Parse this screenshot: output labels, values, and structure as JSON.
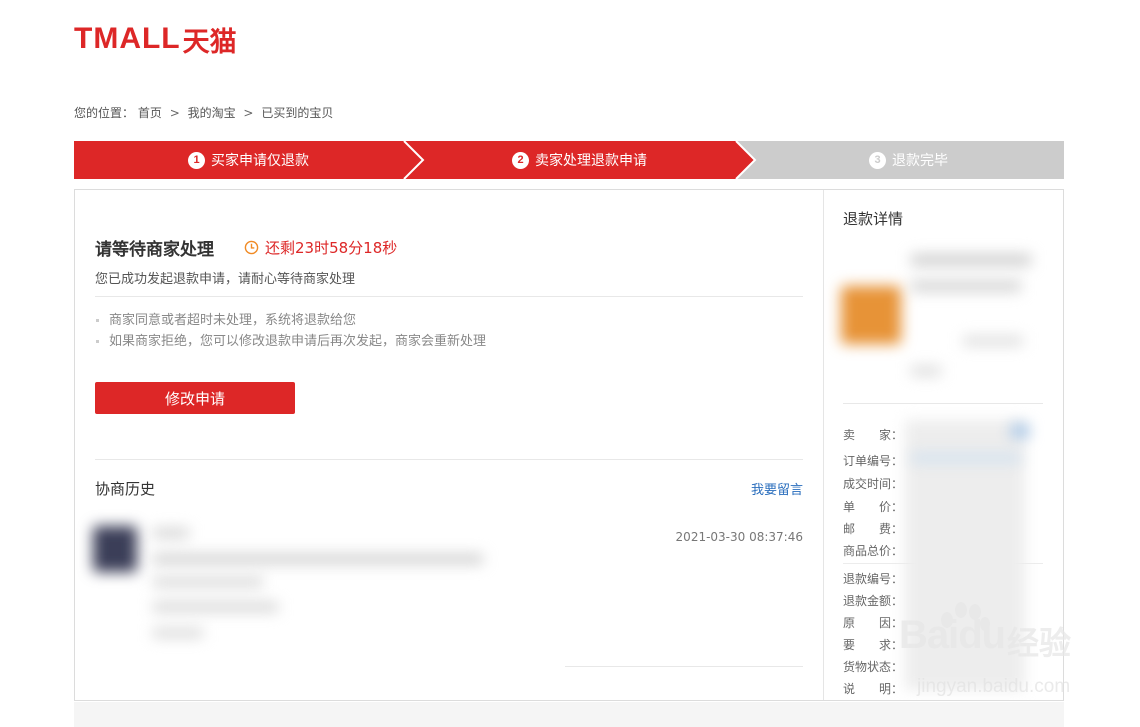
{
  "header": {
    "logo_latin": "TMALL",
    "logo_cn": "天猫"
  },
  "breadcrumb": {
    "prefix": "您的位置：",
    "items": [
      "首页",
      "我的淘宝",
      "已买到的宝贝"
    ],
    "separator": ">"
  },
  "steps": [
    {
      "num": "1",
      "label": "买家申请仅退款",
      "state": "active"
    },
    {
      "num": "2",
      "label": "卖家处理退款申请",
      "state": "active"
    },
    {
      "num": "3",
      "label": "退款完毕",
      "state": "pending"
    }
  ],
  "colors": {
    "brand_red": "#dd2727",
    "step_grey": "#cccccc",
    "link_blue": "#2a6ebd"
  },
  "status": {
    "title": "请等待商家处理",
    "countdown": "还剩23时58分18秒",
    "subtitle": "您已成功发起退款申请，请耐心等待商家处理",
    "tips": [
      "商家同意或者超时未处理，系统将退款给您",
      "如果商家拒绝，您可以修改退款申请后再次发起，商家会重新处理"
    ],
    "modify_button": "修改申请"
  },
  "history": {
    "title": "协商历史",
    "leave_message": "我要留言",
    "entries": [
      {
        "time": "2021-03-30 08:37:46"
      }
    ]
  },
  "refund_detail": {
    "title": "退款详情",
    "labels": {
      "seller": "卖　　家：",
      "order_no": "订单编号：",
      "deal_time": "成交时间：",
      "unit_price": "单　　价：",
      "shipping": "邮　　费：",
      "total": "商品总价：",
      "refund_no": "退款编号：",
      "refund_amount": "退款金额：",
      "reason": "原　　因：",
      "request": "要　　求：",
      "goods_status": "货物状态：",
      "note": "说　　明："
    }
  },
  "watermark": {
    "text": "Baidu",
    "cn": "经验",
    "url": "jingyan.baidu.com"
  }
}
